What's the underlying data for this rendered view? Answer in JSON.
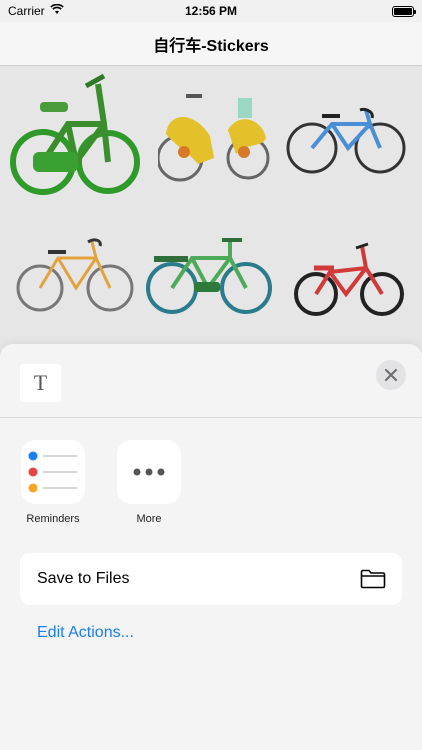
{
  "status_bar": {
    "carrier": "Carrier",
    "time": "12:56 PM",
    "battery_level": 1.0
  },
  "nav": {
    "title": "自行车-Stickers"
  },
  "stickers": [
    {
      "name": "green-bicycle-sticker"
    },
    {
      "name": "yellow-scooter-bicycle-sticker"
    },
    {
      "name": "blue-road-bicycle-sticker"
    },
    {
      "name": "orange-bicycle-sticker"
    },
    {
      "name": "green-city-bicycle-sticker"
    },
    {
      "name": "red-bicycle-sticker"
    }
  ],
  "sheet": {
    "thumbnail_glyph": "T",
    "apps": [
      {
        "label": "Reminders",
        "icon": "reminders-icon"
      },
      {
        "label": "More",
        "icon": "more-icon"
      }
    ],
    "actions": [
      {
        "label": "Save to Files",
        "icon": "folder-icon"
      }
    ],
    "edit_actions_label": "Edit Actions..."
  },
  "colors": {
    "accent": "#1a7ef5",
    "reminder_blue": "#1a7ef5",
    "reminder_red": "#e8453c",
    "reminder_orange": "#f5a623"
  }
}
